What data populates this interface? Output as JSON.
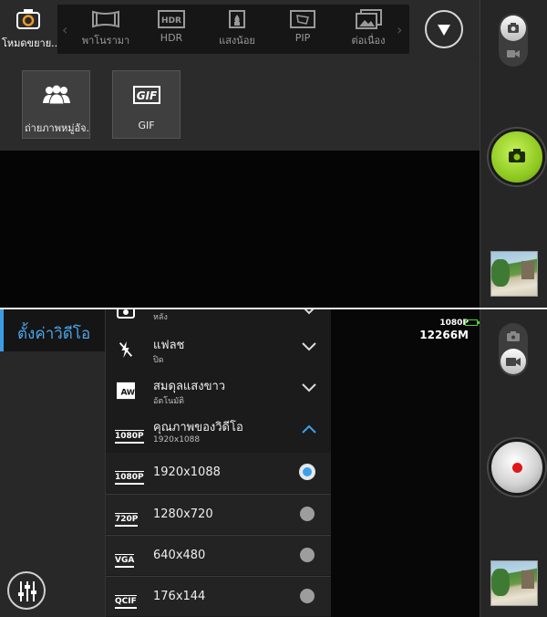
{
  "top": {
    "mode_current": {
      "label": "โหมดขยาย..."
    },
    "modes": [
      {
        "label": "พาโนรามา",
        "icon": "panorama-icon"
      },
      {
        "label": "HDR",
        "icon": "hdr-icon"
      },
      {
        "label": "แสงน้อย",
        "icon": "low-light-icon"
      },
      {
        "label": "PIP",
        "icon": "pip-icon"
      },
      {
        "label": "ต่อเนื่อง",
        "icon": "burst-icon"
      }
    ],
    "drawer": [
      {
        "label": "ถ่ายภาพหมู่อัจ...",
        "icon": "group-icon"
      },
      {
        "label": "GIF",
        "icon": "gif-icon"
      }
    ]
  },
  "bottom": {
    "settings_title": "ตั้งค่าวิดีโอ",
    "rows": [
      {
        "title": "",
        "sub": "หลัง",
        "icon": "camera-rear-icon"
      },
      {
        "title": "แฟลช",
        "sub": "ปิด",
        "icon": "flash-off-icon"
      },
      {
        "title": "สมดุลแสงขาว",
        "sub": "อัตโนมัติ",
        "icon": "white-balance-auto-icon"
      },
      {
        "title": "คุณภาพของวิดีโอ",
        "sub": "1920x1088",
        "icon": "video-quality-icon",
        "badge": "1080P"
      }
    ],
    "options": [
      {
        "badge": "1080P",
        "label": "1920x1088",
        "selected": true
      },
      {
        "badge": "720P",
        "label": "1280x720",
        "selected": false
      },
      {
        "badge": "VGA",
        "label": "640x480",
        "selected": false
      },
      {
        "badge": "QCIF",
        "label": "176x144",
        "selected": false
      }
    ],
    "status": {
      "resolution": "1080P",
      "remaining": "12266M"
    }
  },
  "colors": {
    "accent": "#3d9de3",
    "shutter_green": "#8bc61d",
    "record": "#e01818",
    "battery": "#52d12f"
  }
}
